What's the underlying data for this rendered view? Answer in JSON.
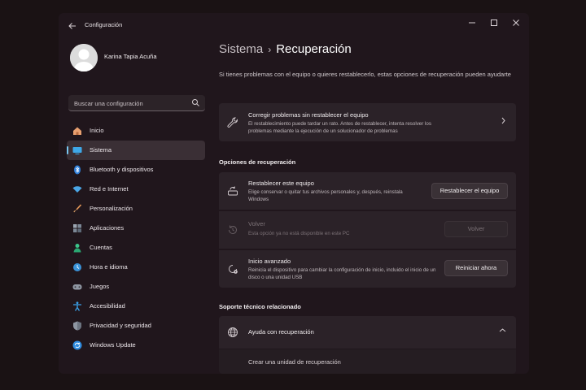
{
  "window": {
    "title": "Configuración"
  },
  "profile": {
    "name": "Karina Tapia Acuña"
  },
  "search": {
    "placeholder": "Buscar una configuración"
  },
  "sidebar": {
    "items": [
      {
        "label": "Inicio",
        "icon": "home-icon"
      },
      {
        "label": "Sistema",
        "icon": "monitor-icon",
        "active": true
      },
      {
        "label": "Bluetooth y dispositivos",
        "icon": "bluetooth-icon"
      },
      {
        "label": "Red e Internet",
        "icon": "wifi-icon"
      },
      {
        "label": "Personalización",
        "icon": "brush-icon"
      },
      {
        "label": "Aplicaciones",
        "icon": "apps-icon"
      },
      {
        "label": "Cuentas",
        "icon": "person-icon"
      },
      {
        "label": "Hora e idioma",
        "icon": "clock-globe-icon"
      },
      {
        "label": "Juegos",
        "icon": "gamepad-icon"
      },
      {
        "label": "Accesibilidad",
        "icon": "accessibility-icon"
      },
      {
        "label": "Privacidad y seguridad",
        "icon": "shield-icon"
      },
      {
        "label": "Windows Update",
        "icon": "update-icon"
      }
    ]
  },
  "main": {
    "breadcrumb_parent": "Sistema",
    "breadcrumb_sep": "›",
    "breadcrumb_current": "Recuperación",
    "intro": "Si tienes problemas con el equipo o quieres restablecerlo, estas opciones de recuperación pueden ayudarte",
    "fix_card": {
      "title": "Corregir problemas sin restablecer el equipo",
      "desc": "El restablecimiento puede tardar un rato. Antes de restablecer, intenta resolver los problemas mediante la ejecución de un solucionador de problemas"
    },
    "recovery_section_title": "Opciones de recuperación",
    "reset": {
      "title": "Restablecer este equipo",
      "desc": "Elige conservar o quitar tus archivos personales y, después, reinstala Windows",
      "button": "Restablecer el equipo"
    },
    "goback": {
      "title": "Volver",
      "desc": "Esta opción ya no está disponible en este PC",
      "button": "Volver",
      "enabled": false
    },
    "advanced": {
      "title": "Inicio avanzado",
      "desc": "Reinicia el dispositivo para cambiar la configuración de inicio, incluido el inicio de un disco o una unidad USB",
      "button": "Reiniciar ahora"
    },
    "support_section_title": "Soporte técnico relacionado",
    "help": {
      "title": "Ayuda con recuperación",
      "expanded": true,
      "link": "Crear una unidad de recuperación"
    }
  },
  "colors": {
    "accent": "#78c6ef",
    "window_bg": "#20161c",
    "card_bg": "#2b2228"
  }
}
